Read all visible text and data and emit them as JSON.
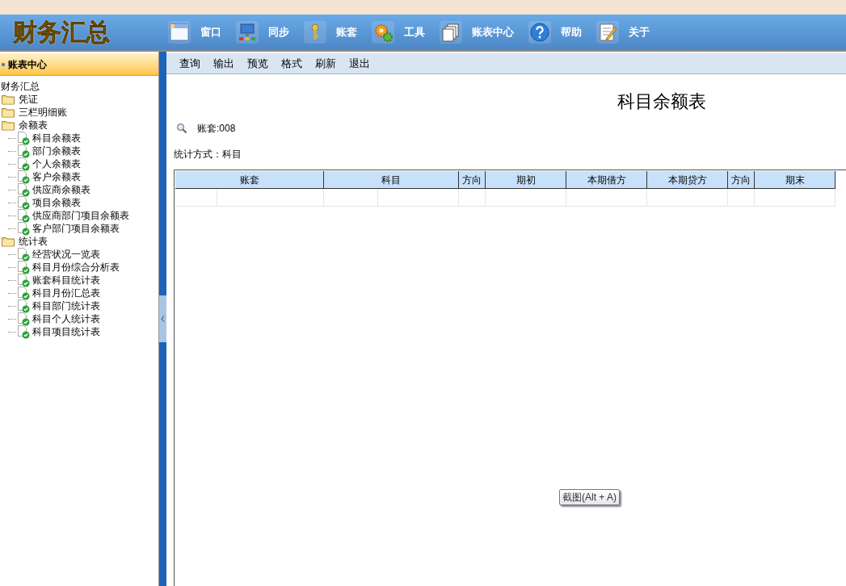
{
  "app": {
    "logo": "财务汇总"
  },
  "main_menu": [
    "窗口",
    "同步",
    "账套",
    "工具",
    "账表中心",
    "帮助",
    "关于"
  ],
  "sidebar": {
    "title": "账表中心",
    "tree": [
      {
        "label": "财务汇总",
        "kind": "root",
        "children": [
          {
            "label": "凭证",
            "kind": "folder"
          },
          {
            "label": "三栏明细账",
            "kind": "folder"
          },
          {
            "label": "余额表",
            "kind": "folder",
            "children": [
              {
                "label": "科目余额表",
                "kind": "report"
              },
              {
                "label": "部门余额表",
                "kind": "report"
              },
              {
                "label": "个人余额表",
                "kind": "report"
              },
              {
                "label": "客户余额表",
                "kind": "report"
              },
              {
                "label": "供应商余额表",
                "kind": "report"
              },
              {
                "label": "项目余额表",
                "kind": "report"
              },
              {
                "label": "供应商部门项目余额表",
                "kind": "report"
              },
              {
                "label": "客户部门项目余额表",
                "kind": "report"
              }
            ]
          },
          {
            "label": "统计表",
            "kind": "folder",
            "children": [
              {
                "label": "经营状况一览表",
                "kind": "report"
              },
              {
                "label": "科目月份综合分析表",
                "kind": "report"
              },
              {
                "label": "账套科目统计表",
                "kind": "report"
              },
              {
                "label": "科目月份汇总表",
                "kind": "report"
              },
              {
                "label": "科目部门统计表",
                "kind": "report"
              },
              {
                "label": "科目个人统计表",
                "kind": "report"
              },
              {
                "label": "科目项目统计表",
                "kind": "report"
              }
            ]
          }
        ]
      }
    ]
  },
  "toolbar": [
    "查询",
    "输出",
    "预览",
    "格式",
    "刷新",
    "退出"
  ],
  "report": {
    "title": "科目余额表",
    "account_set": "账套:008",
    "stat_method": "统计方式：科目",
    "table": {
      "columns": [
        "账套",
        "科目",
        "方向",
        "期初",
        "本期借方",
        "本期贷方",
        "方向",
        "期末"
      ]
    }
  },
  "tooltip": "截图(Alt + A)"
}
